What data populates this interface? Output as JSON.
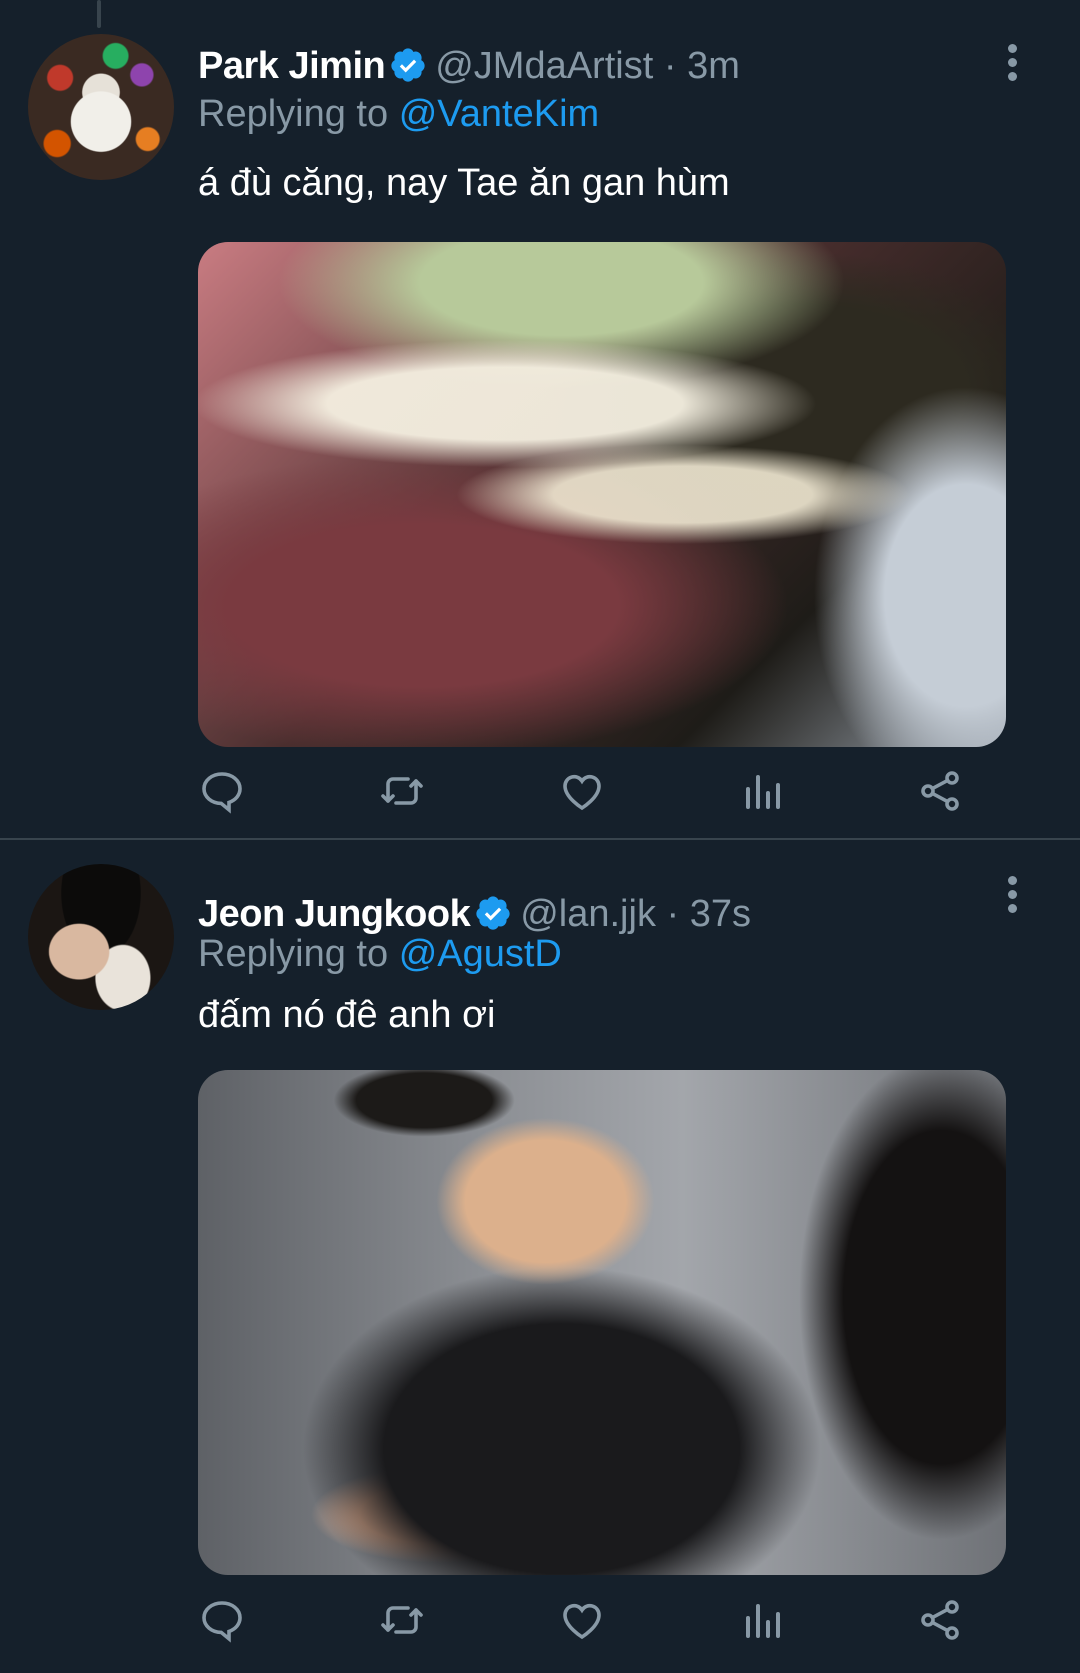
{
  "tweets": [
    {
      "name": "Park Jimin",
      "handle": "@JMdaArtist",
      "separator": "·",
      "time": "3m",
      "replying_prefix": "Replying to",
      "replying_to": "@VanteKim",
      "text": "á đù căng, nay Tae ăn gan hùm",
      "verified": true
    },
    {
      "name": "Jeon Jungkook",
      "handle": "@lan.jjk",
      "separator": "·",
      "time": "37s",
      "replying_prefix": "Replying to",
      "replying_to": "@AgustD",
      "text": "đấm nó đê anh ơi",
      "verified": true
    }
  ],
  "icons": {
    "reply": "reply-icon",
    "retweet": "retweet-icon",
    "like": "heart-icon",
    "analytics": "analytics-icon",
    "share": "share-icon",
    "more": "more-vertical-icon",
    "verified": "verified-badge-icon"
  },
  "colors": {
    "background": "#15202b",
    "muted": "#8899a6",
    "accent": "#1d9bf0",
    "divider": "#38444d"
  }
}
